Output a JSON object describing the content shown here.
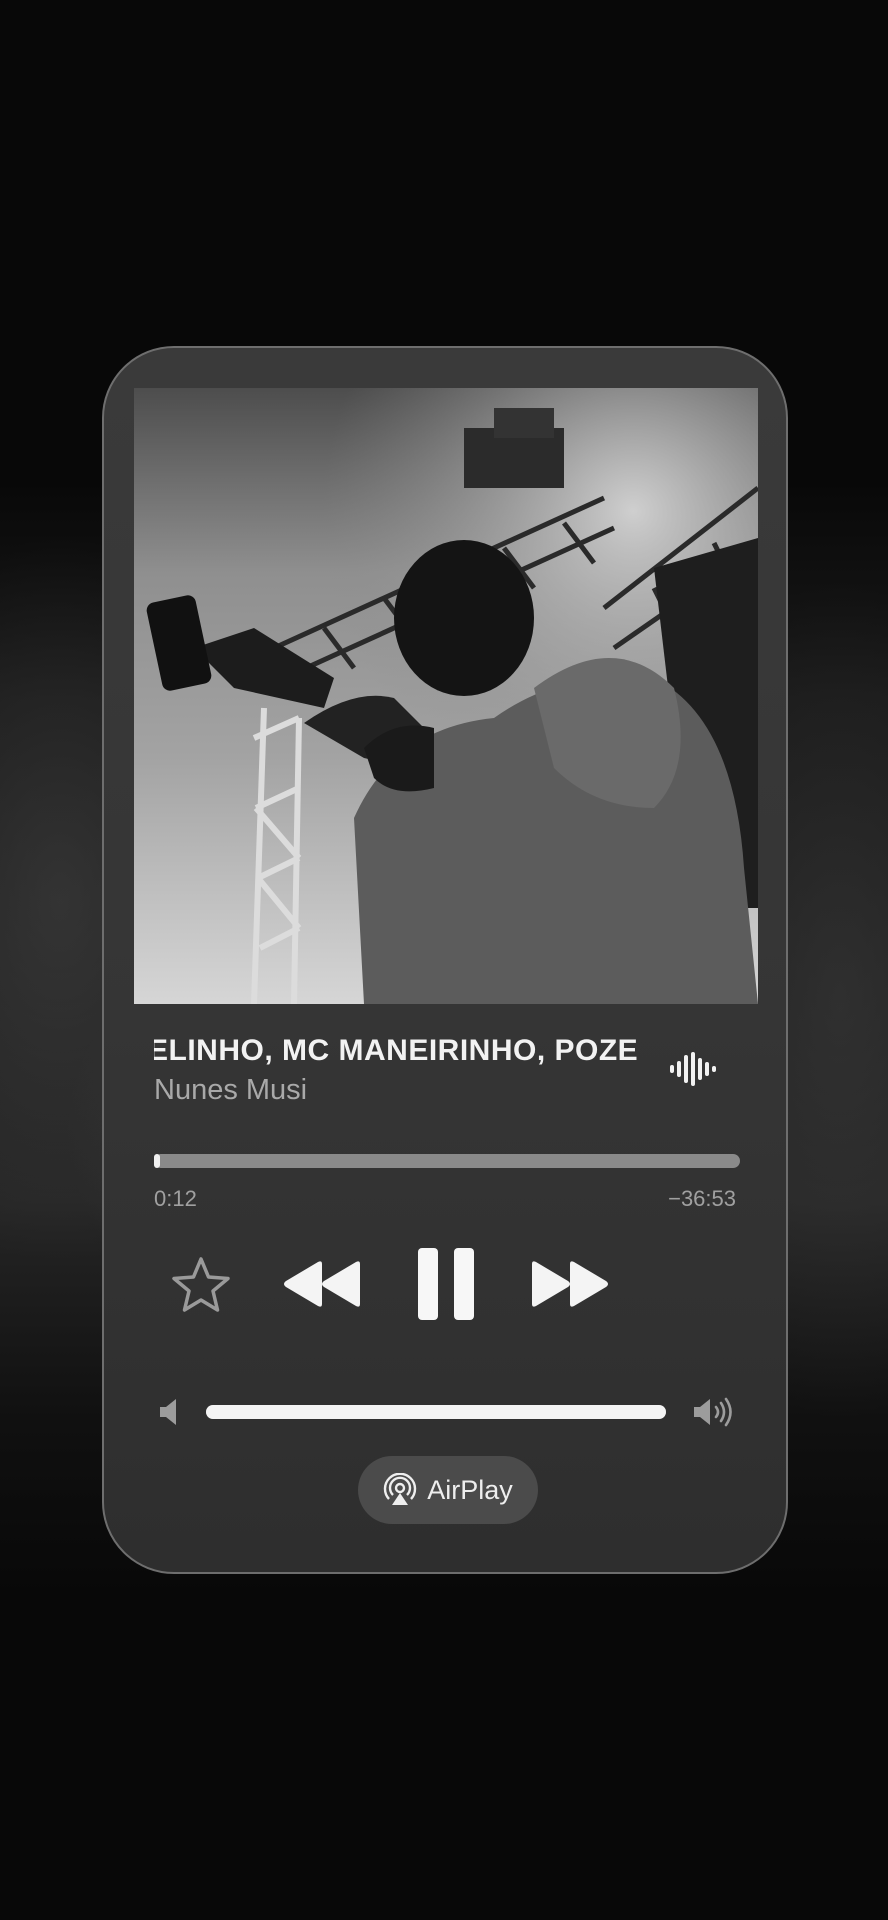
{
  "now_playing": {
    "title": "ELINHO, MC MANEIRINHO, POZE",
    "artist": "Nunes Musi",
    "elapsed": "0:12",
    "remaining": "−36:53",
    "progress_fraction": 0.01,
    "volume_fraction": 1.0,
    "is_playing": true,
    "is_favorite": false
  },
  "controls": {
    "favorite_icon": "star-outline-icon",
    "previous_icon": "rewind-icon",
    "play_pause_icon": "pause-icon",
    "next_icon": "fast-forward-icon",
    "volume_low_icon": "speaker-icon",
    "volume_high_icon": "speaker-wave-icon",
    "lyrics_icon": "waveform-icon"
  },
  "airplay": {
    "label": "AirPlay",
    "icon": "airplay-icon"
  },
  "colors": {
    "card_background": "#363636",
    "progress_fill": "#f0f0f0",
    "progress_track": "#8a8a8a",
    "text_primary": "#f2f2f2",
    "text_secondary": "#a9a9a9"
  }
}
